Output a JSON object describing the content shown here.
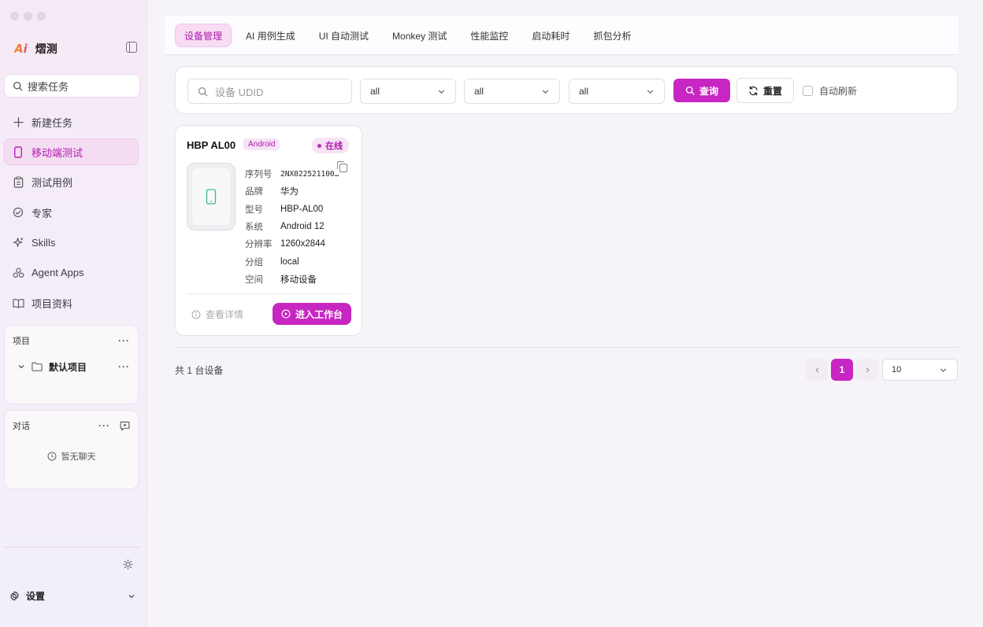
{
  "app": {
    "name": "熠测",
    "logo_text": "Ai"
  },
  "sidebar": {
    "search_placeholder": "搜索任务",
    "items": [
      {
        "label": "新建任务",
        "icon": "plus-icon"
      },
      {
        "label": "移动端测试",
        "icon": "phone-icon",
        "active": true
      },
      {
        "label": "测试用例",
        "icon": "clipboard-icon"
      },
      {
        "label": "专家",
        "icon": "check-circle-icon"
      },
      {
        "label": "Skills",
        "icon": "sparkle-icon"
      },
      {
        "label": "Agent Apps",
        "icon": "apps-icon"
      },
      {
        "label": "项目资料",
        "icon": "book-icon"
      }
    ],
    "projects": {
      "title": "项目",
      "items": [
        {
          "label": "默认项目"
        }
      ]
    },
    "chats": {
      "title": "对话",
      "empty": "暂无聊天"
    },
    "settings_label": "设置"
  },
  "tabs": [
    {
      "label": "设备管理",
      "active": true
    },
    {
      "label": "AI 用例生成"
    },
    {
      "label": "UI 自动测试"
    },
    {
      "label": "Monkey 测试"
    },
    {
      "label": "性能监控"
    },
    {
      "label": "启动耗时"
    },
    {
      "label": "抓包分析"
    }
  ],
  "filters": {
    "udid_placeholder": "设备 UDID",
    "selects": [
      "all",
      "all",
      "all"
    ],
    "query_label": "查询",
    "reset_label": "重置",
    "auto_refresh_label": "自动刷新",
    "auto_refresh_checked": false
  },
  "devices": [
    {
      "name": "HBP AL00",
      "os": "Android",
      "status": "在线",
      "fields": [
        {
          "k": "序列号",
          "v": "2NX022521100..."
        },
        {
          "k": "品牌",
          "v": "华为"
        },
        {
          "k": "型号",
          "v": "HBP-AL00"
        },
        {
          "k": "系统",
          "v": "Android 12"
        },
        {
          "k": "分辨率",
          "v": "1260x2844"
        },
        {
          "k": "分组",
          "v": "local"
        },
        {
          "k": "空间",
          "v": "移动设备"
        }
      ],
      "detail_label": "查看详情",
      "workbench_label": "进入工作台"
    }
  ],
  "pagination": {
    "total_text": "共 1 台设备",
    "current_page": "1",
    "page_size": "10"
  },
  "colors": {
    "accent": "#c726c2",
    "accent_light": "#f7e3f5",
    "sidebar_bg": "#f6e9f6"
  }
}
